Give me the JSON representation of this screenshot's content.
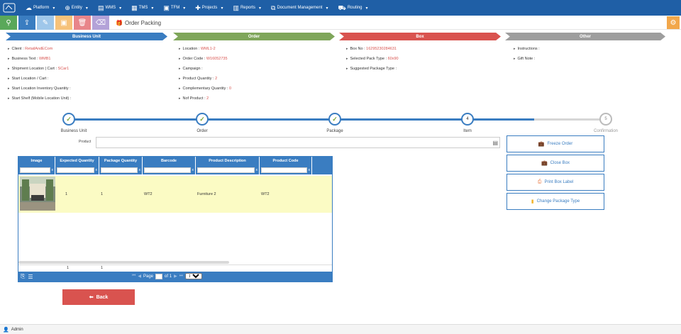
{
  "nav": {
    "items": [
      {
        "label": "Platform",
        "icon": "cloud-icon"
      },
      {
        "label": "Entity",
        "icon": "globe-icon"
      },
      {
        "label": "WMS",
        "icon": "warehouse-icon"
      },
      {
        "label": "TMS",
        "icon": "truck-icon"
      },
      {
        "label": "TFM",
        "icon": "server-icon"
      },
      {
        "label": "Projects",
        "icon": "plus-icon"
      },
      {
        "label": "Reports",
        "icon": "report-icon"
      },
      {
        "label": "Document Management",
        "icon": "document-icon"
      },
      {
        "label": "Routing",
        "icon": "road-icon"
      }
    ]
  },
  "toolbar": {
    "title": "Order Packing",
    "buttons": [
      {
        "name": "search",
        "color": "#5aa85a"
      },
      {
        "name": "upload",
        "color": "#3a7dc1"
      },
      {
        "name": "edit",
        "color": "#9fc7ea"
      },
      {
        "name": "save",
        "color": "#f6c27a"
      },
      {
        "name": "delete",
        "color": "#e8858a"
      },
      {
        "name": "eraser",
        "color": "#b3a2d8"
      }
    ]
  },
  "sections": {
    "business_unit": {
      "title": "Business Unit",
      "color": "#3a7dc1"
    },
    "order": {
      "title": "Order",
      "color": "#7fa65a"
    },
    "box": {
      "title": "Box",
      "color": "#d9534f"
    },
    "other": {
      "title": "Other",
      "color": "#9e9e9e"
    }
  },
  "fields": {
    "client": {
      "label": "Client :",
      "value": "RetailAndECom"
    },
    "business_text": {
      "label": "Business Text :",
      "value": "WMB1"
    },
    "shipment_location": {
      "label": "Shipment Location | Cart :",
      "value": "SCar1"
    },
    "start_location": {
      "label": "Start Location / Cart :",
      "value": ""
    },
    "start_inventory": {
      "label": "Start Location Inventory Quantity :",
      "value": ""
    },
    "start_shelf": {
      "label": "Start Shelf (Mobile Location Unit) :",
      "value": ""
    },
    "location": {
      "label": "Location :",
      "value": "WML1-2"
    },
    "order_code": {
      "label": "Order Code :",
      "value": "W16052735"
    },
    "campaign": {
      "label": "Campaign :",
      "value": ""
    },
    "product_quantity": {
      "label": "Product Quantity :",
      "value": "2"
    },
    "complementary_quantity": {
      "label": "Complementary Quantity :",
      "value": "0"
    },
    "nof_product": {
      "label": "Nof Product :",
      "value": "2"
    },
    "box_no": {
      "label": "Box No :",
      "value": "16295230284631"
    },
    "pack_type": {
      "label": "Selected Pack Type :",
      "value": "60x90"
    },
    "suggested_package": {
      "label": "Suggested Package Type :",
      "value": ""
    },
    "instructions": {
      "label": "Instructions :",
      "value": ""
    },
    "gift_note": {
      "label": "Gift Note :",
      "value": ""
    }
  },
  "steps": [
    {
      "label": "Business Unit",
      "state": "done",
      "num": ""
    },
    {
      "label": "Order",
      "state": "done",
      "num": ""
    },
    {
      "label": "Package",
      "state": "done",
      "num": ""
    },
    {
      "label": "Item",
      "state": "active",
      "num": "4"
    },
    {
      "label": "Confirmation",
      "state": "pending",
      "num": "5"
    }
  ],
  "product": {
    "label": "Product"
  },
  "grid": {
    "columns": [
      "Image",
      "Expected Quantity",
      "Package Quantity",
      "Barcode",
      "Product Description",
      "Product Code"
    ],
    "rows": [
      {
        "expected": "1",
        "package": "1",
        "barcode": "WT2",
        "description": "Furniture 2",
        "code": "WT2"
      }
    ],
    "totals": {
      "expected": "1",
      "package": "1"
    },
    "pager": {
      "page_label": "Page",
      "of_label": "of 1",
      "page_size": "100"
    }
  },
  "side_buttons": [
    {
      "label": "Freeze Order",
      "icon": "briefcase-icon"
    },
    {
      "label": "Close Box",
      "icon": "briefcase-icon"
    },
    {
      "label": "Print Box Label",
      "icon": "print-icon"
    },
    {
      "label": "Change Package Type",
      "icon": "package-icon"
    }
  ],
  "back_button": {
    "label": "Back"
  },
  "footer": {
    "user": "Admin"
  }
}
